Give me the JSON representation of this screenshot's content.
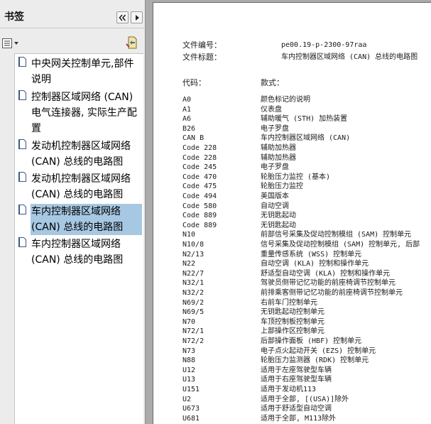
{
  "bookmarks_pane": {
    "title": "书签",
    "items": [
      {
        "label": "中央网关控制单元,部件说明",
        "selected": false
      },
      {
        "label": "控制器区域网络 (CAN) 电气连接器, 实际生产配置",
        "selected": false
      },
      {
        "label": "发动机控制器区域网络 (CAN) 总线的电路图",
        "selected": false
      },
      {
        "label": "发动机控制器区域网络 (CAN) 总线的电路图",
        "selected": false
      },
      {
        "label": "车内控制器区域网络 (CAN) 总线的电路图",
        "selected": true
      },
      {
        "label": "车内控制器区域网络 (CAN) 总线的电路图",
        "selected": false
      }
    ]
  },
  "document": {
    "file_number_label": "文件编号：",
    "file_number": "pe00.19-p-2300-97raa",
    "file_title_label": "文件标题：",
    "file_title": "车内控制器区域网络 (CAN) 总线的电路图",
    "code_header": "代码：",
    "desc_header": "款式：",
    "rows": [
      {
        "code": "A0",
        "desc": "颜色标记的说明"
      },
      {
        "code": "A1",
        "desc": "仪表盘"
      },
      {
        "code": "A6",
        "desc": "辅助暖气 (STH) 加热装置"
      },
      {
        "code": "B26",
        "desc": "电子罗盘"
      },
      {
        "code": "CAN B",
        "desc": "车内控制器区域网络 (CAN)"
      },
      {
        "code": "Code 228",
        "desc": "辅助加热器"
      },
      {
        "code": "Code 228",
        "desc": "辅助加热器"
      },
      {
        "code": "Code 245",
        "desc": "电子罗盘"
      },
      {
        "code": "Code 470",
        "desc": "轮胎压力监控 (基本)"
      },
      {
        "code": "Code 475",
        "desc": "轮胎压力监控"
      },
      {
        "code": "Code 494",
        "desc": "美国版本"
      },
      {
        "code": "Code 580",
        "desc": "自动空调"
      },
      {
        "code": "Code 889",
        "desc": "无钥匙起动"
      },
      {
        "code": "Code 889",
        "desc": "无钥匙起动"
      },
      {
        "code": "N10",
        "desc": "前部信号采集及促动控制模组 (SAM) 控制单元"
      },
      {
        "code": "N10/8",
        "desc": "信号采集及促动控制模组 (SAM) 控制单元, 后部"
      },
      {
        "code": "N2/13",
        "desc": "重量传感系统 (WSS) 控制单元"
      },
      {
        "code": "N22",
        "desc": "自动空调 (KLA) 控制和操作单元"
      },
      {
        "code": "N22/7",
        "desc": "舒适型自动空调 (KLA) 控制和操作单元"
      },
      {
        "code": "N32/1",
        "desc": "驾驶员侧带记忆功能的前座椅调节控制单元"
      },
      {
        "code": "N32/2",
        "desc": "前排乘客侧带记忆功能的前座椅调节控制单元"
      },
      {
        "code": "N69/2",
        "desc": "右前车门控制单元"
      },
      {
        "code": "N69/5",
        "desc": "无钥匙起动控制单元"
      },
      {
        "code": "N70",
        "desc": "车顶控制板控制单元"
      },
      {
        "code": "N72/1",
        "desc": "上部操作区控制单元"
      },
      {
        "code": "N72/2",
        "desc": "后部操作面板 (HBF) 控制单元"
      },
      {
        "code": "N73",
        "desc": "电子点火起动开关 (EZS) 控制单元"
      },
      {
        "code": "N88",
        "desc": "轮胎压力监测器 (RDK) 控制单元"
      },
      {
        "code": "U12",
        "desc": "适用于左座驾驶型车辆"
      },
      {
        "code": "U13",
        "desc": "适用于右座驾驶型车辆"
      },
      {
        "code": "U151",
        "desc": "适用于发动机113"
      },
      {
        "code": "U2",
        "desc": "适用于全部, [(USA)]除外"
      },
      {
        "code": "U673",
        "desc": "适用于舒适型自动空调"
      },
      {
        "code": "U681",
        "desc": "适用于全部, M113除外"
      }
    ]
  }
}
